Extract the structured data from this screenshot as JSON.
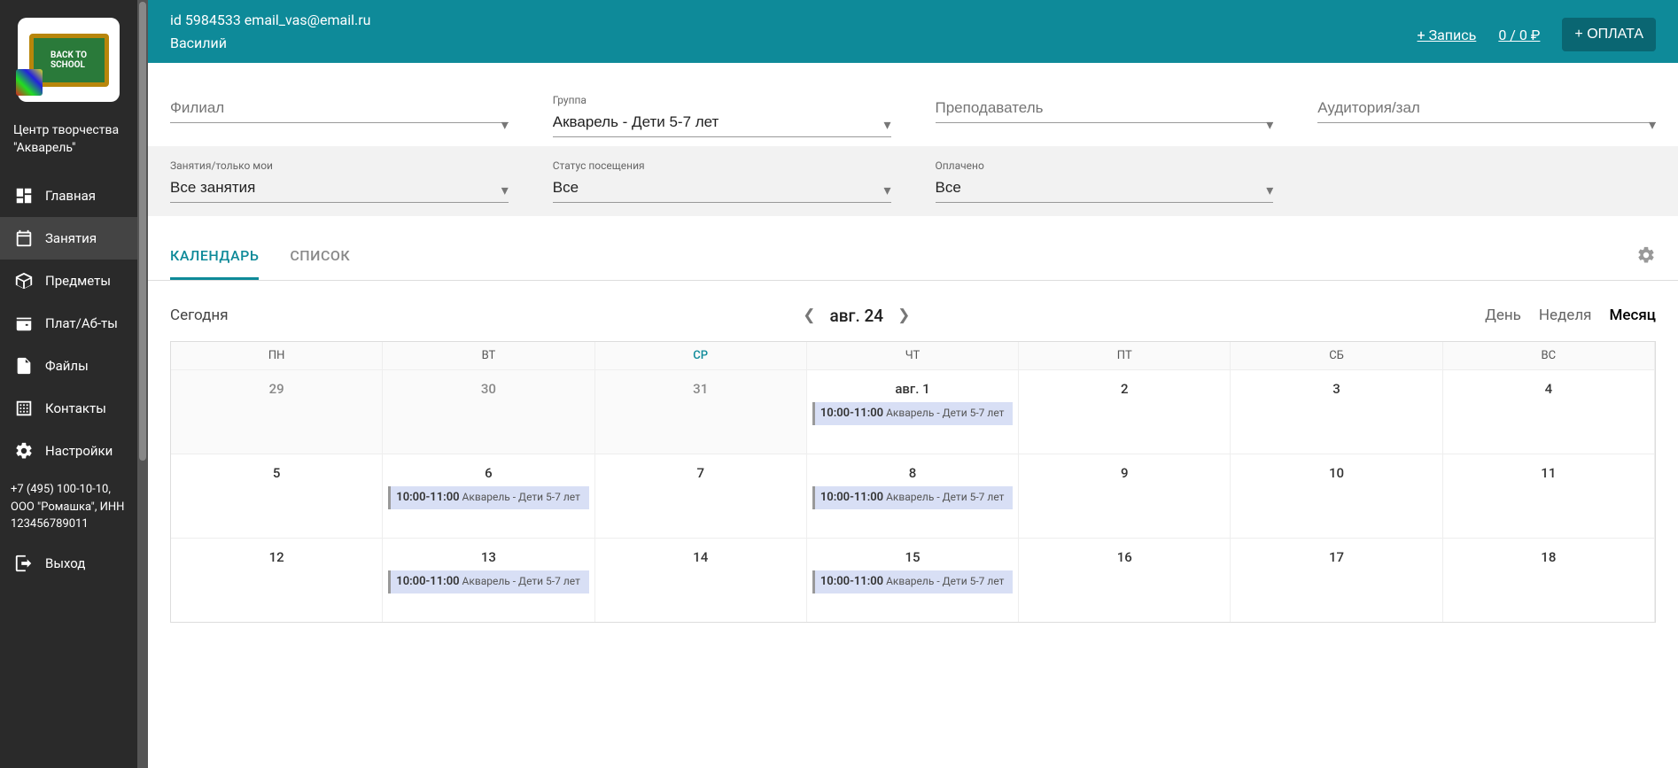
{
  "org": {
    "name": "Центр творчества \"Акварель\""
  },
  "sidebar": {
    "items": [
      {
        "label": "Главная",
        "icon": "dashboard"
      },
      {
        "label": "Занятия",
        "icon": "calendar",
        "active": true
      },
      {
        "label": "Предметы",
        "icon": "cube"
      },
      {
        "label": "Плат/Аб-ты",
        "icon": "wallet"
      },
      {
        "label": "Файлы",
        "icon": "file"
      },
      {
        "label": "Контакты",
        "icon": "building"
      },
      {
        "label": "Настройки",
        "icon": "gear"
      }
    ],
    "footer": "+7 (495) 100-10-10, ООО \"Ромашка\", ИНН 123456789011",
    "logout": "Выход"
  },
  "topbar": {
    "id_line": "id 5984533 email_vas@email.ru",
    "name": "Василий",
    "add_record": "+ Запись",
    "balance": "0 / 0 ₽",
    "pay_btn": "+ ОПЛАТА"
  },
  "filters": {
    "branch": {
      "label": "",
      "placeholder": "Филиал"
    },
    "group": {
      "label": "Группа",
      "value": "Акварель - Дети 5-7 лет"
    },
    "teacher": {
      "label": "",
      "placeholder": "Преподаватель"
    },
    "room": {
      "label": "",
      "placeholder": "Аудитория/зал"
    },
    "lessons": {
      "label": "Занятия/только мои",
      "value": "Все занятия"
    },
    "status": {
      "label": "Статус посещения",
      "value": "Все"
    },
    "paid": {
      "label": "Оплачено",
      "value": "Все"
    }
  },
  "tabs": {
    "calendar": "КАЛЕНДАРЬ",
    "list": "СПИСОК"
  },
  "cal": {
    "today": "Сегодня",
    "month": "авг. 24",
    "views": {
      "day": "День",
      "week": "Неделя",
      "month": "Месяц"
    },
    "weekdays": [
      "ПН",
      "ВТ",
      "СР",
      "ЧТ",
      "ПТ",
      "СБ",
      "ВС"
    ],
    "today_index": 2,
    "event": {
      "time": "10:00-11:00",
      "name": "Акварель - Дети 5-7 лет"
    },
    "rows": [
      {
        "dates": [
          "29",
          "30",
          "31",
          "авг. 1",
          "2",
          "3",
          "4"
        ],
        "prev_count": 3,
        "events_at": [
          3
        ]
      },
      {
        "dates": [
          "5",
          "6",
          "7",
          "8",
          "9",
          "10",
          "11"
        ],
        "prev_count": 0,
        "events_at": [
          1,
          3
        ]
      },
      {
        "dates": [
          "12",
          "13",
          "14",
          "15",
          "16",
          "17",
          "18"
        ],
        "prev_count": 0,
        "events_at": [
          1,
          3
        ]
      }
    ]
  }
}
